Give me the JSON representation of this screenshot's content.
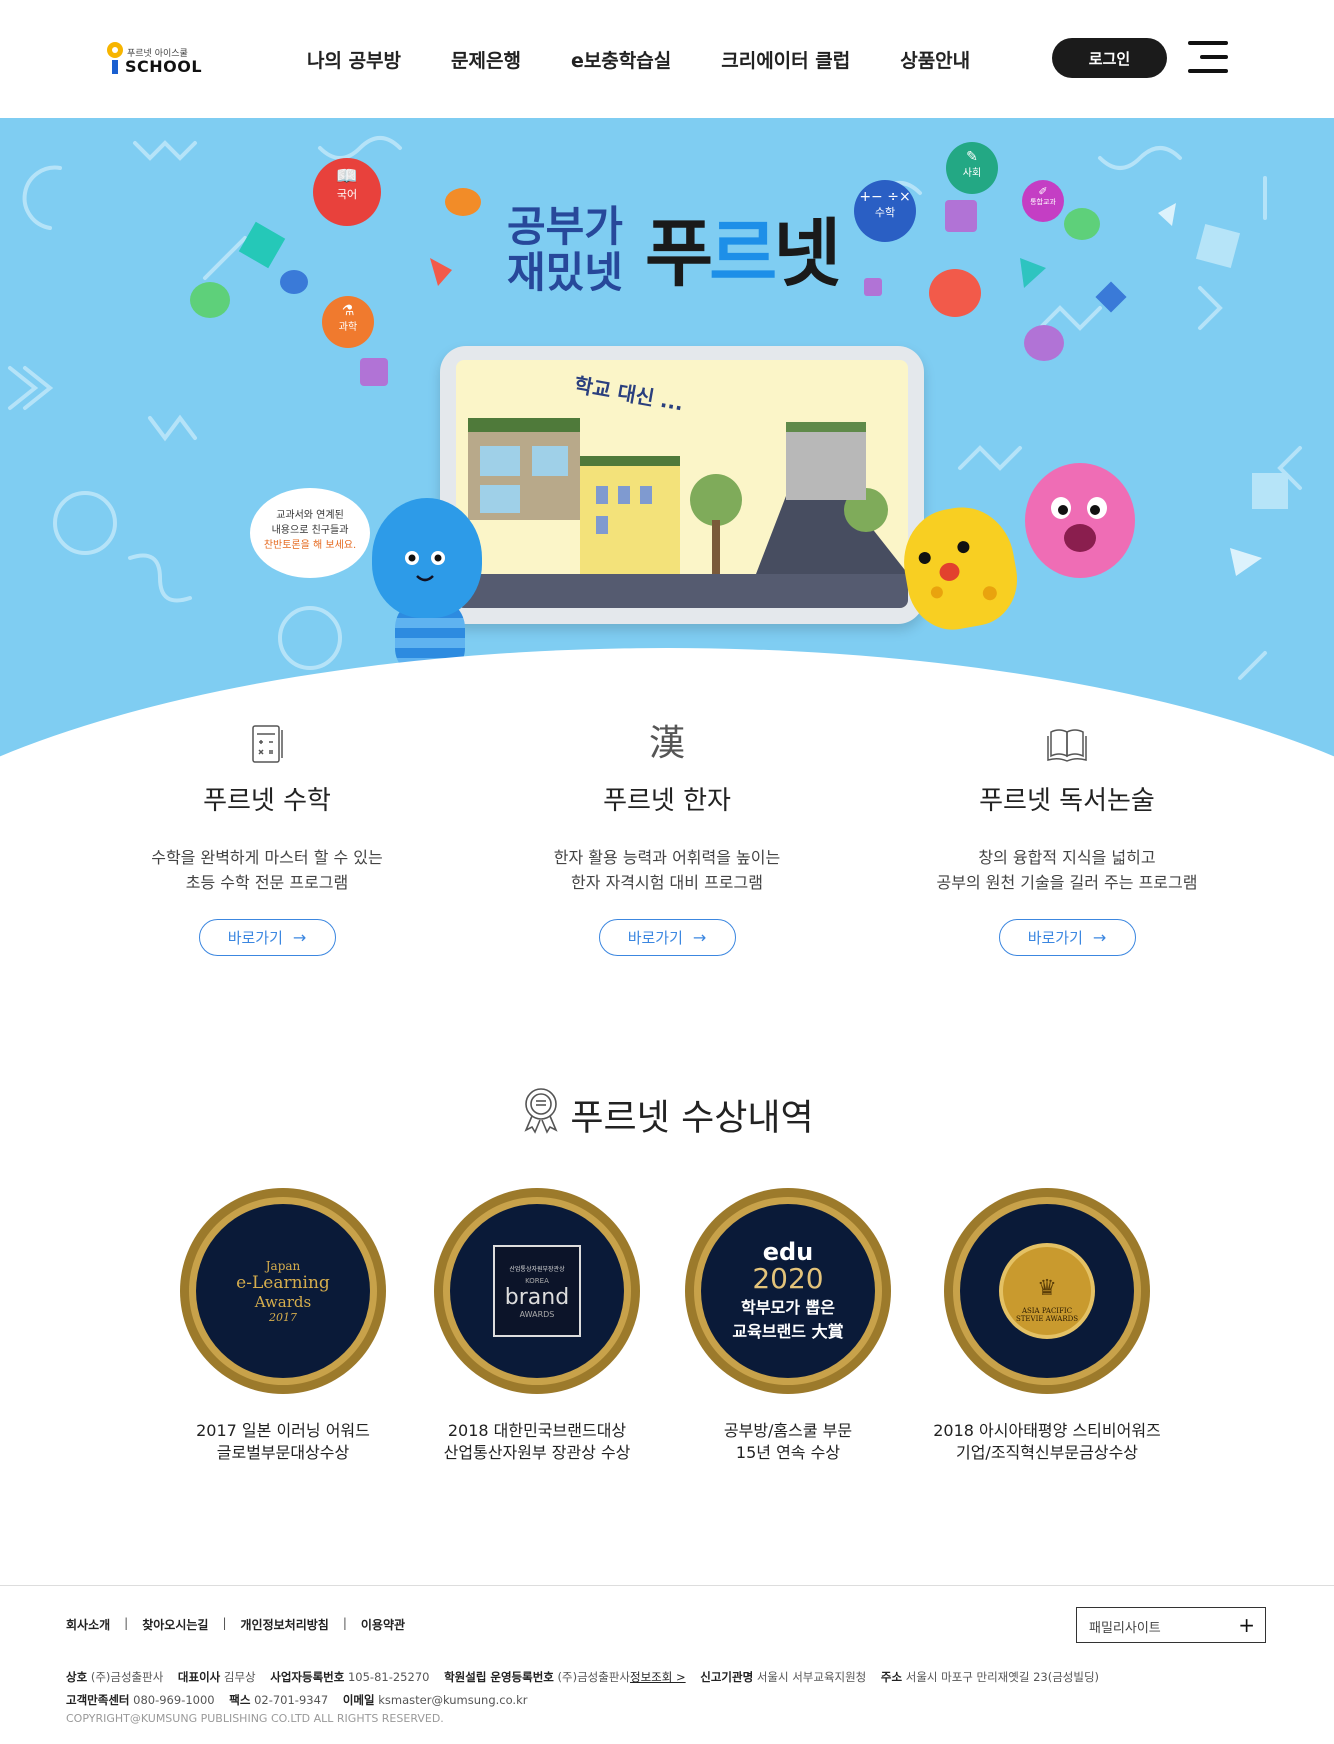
{
  "header": {
    "logo_small": "푸르넷 아이스쿨",
    "logo_big": "SCHOOL",
    "nav": [
      "나의 공부방",
      "문제은행",
      "e보충학습실",
      "크리에이터 클럽",
      "상품안내"
    ],
    "login_label": "로그인"
  },
  "hero": {
    "title_line1": "공부가",
    "title_line2": "재밌넷",
    "title_brand": "푸르넷",
    "subjects": [
      "국어",
      "과학",
      "수학",
      "사회",
      "통합교과"
    ],
    "screen_text": "학교 대신 ...",
    "speech": [
      "교과서와 연계된",
      "내용으로 친구들과",
      "찬반토론을 해 보세요."
    ]
  },
  "features": [
    {
      "title": "푸르넷 수학",
      "desc1": "수학을 완벽하게 마스터 할 수 있는",
      "desc2": "초등 수학 전문 프로그램",
      "button": "바로가기",
      "icon": "calculator-icon"
    },
    {
      "title": "푸르넷 한자",
      "desc1": "한자 활용 능력과 어휘력을 높이는",
      "desc2": "한자 자격시험 대비 프로그램",
      "button": "바로가기",
      "icon": "hanja-icon"
    },
    {
      "title": "푸르넷 독서논술",
      "desc1": "창의 융합적 지식을 넓히고",
      "desc2": "공부의 원천 기술을 길러 주는 프로그램",
      "button": "바로가기",
      "icon": "book-icon"
    }
  ],
  "awards": {
    "title": "푸르넷 수상내역",
    "items": [
      {
        "line1": "2017 일본 이러닝 어워드",
        "line2": "글로벌부문대상수상",
        "badge1": "Japan",
        "badge2": "e-Learning",
        "badge3": "Awards",
        "badge4": "2017"
      },
      {
        "line1": "2018 대한민국브랜드대상",
        "line2": "산업통산자원부 장관상 수상",
        "badge1": "산업통상자원부장관상",
        "badge2": "KOREA",
        "badge3": "brand",
        "badge4": "AWARDS"
      },
      {
        "line1": "공부방/홈스쿨 부문",
        "line2": "15년 연속 수상",
        "badge1": "edu",
        "badge2": "2020",
        "badge3": "학부모가 뽑은",
        "badge4": "교육브랜드 大賞"
      },
      {
        "line1": "2018 아시아태평양 스티비어워즈",
        "line2": "기업/조직혁신부문금상수상",
        "badge1": "ASIA PACIFIC",
        "badge2": "STEVIE AWARDS",
        "badge3": "",
        "badge4": ""
      }
    ]
  },
  "footer": {
    "links": [
      "회사소개",
      "찾아오시는길",
      "개인정보처리방침",
      "이용약관"
    ],
    "family_site": "패밀리사이트",
    "info_line1": {
      "company_label": "상호",
      "company": "(주)금성출판사",
      "ceo_label": "대표이사",
      "ceo": "김무상",
      "biz_label": "사업자등록번호",
      "biz": "105-81-25270",
      "academy_label": "학원설립 운영등록번호",
      "academy": "(주)금성출판사",
      "academy_link": "정보조회 >",
      "agency_label": "신고기관명",
      "agency": "서울시 서부교육지원청",
      "addr_label": "주소",
      "addr": "서울시 마포구 만리재옛길 23(금성빌딩)"
    },
    "info_line2": {
      "cs_label": "고객만족센터",
      "cs": "080-969-1000",
      "fax_label": "팩스",
      "fax": "02-701-9347",
      "email_label": "이메일",
      "email": "ksmaster@kumsung.co.kr"
    },
    "copyright": "COPYRIGHT@KUMSUNG PUBLISHING CO.LTD ALL RIGHTS RESERVED."
  }
}
